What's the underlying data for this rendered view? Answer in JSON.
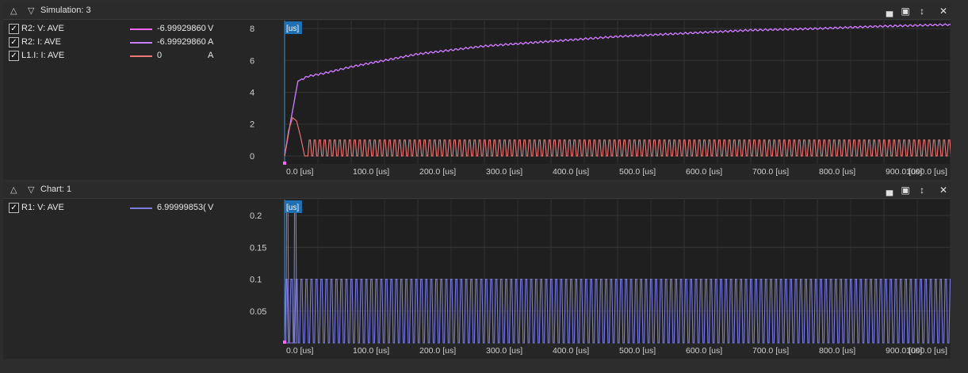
{
  "panes": [
    {
      "title": "Simulation: 3",
      "legend": [
        {
          "name": "R2: V: AVE",
          "value": "-6.99929860",
          "unit": "V",
          "color": "#ff66ff",
          "checked": true
        },
        {
          "name": "R2: I: AVE",
          "value": "-6.99929860",
          "unit": "A",
          "color": "#c77dff",
          "checked": true
        },
        {
          "name": "L1.I: I: AVE",
          "value": "0",
          "unit": "A",
          "color": "#f07878",
          "checked": true
        }
      ],
      "cursor_label": "[us]"
    },
    {
      "title": "Chart: 1",
      "legend": [
        {
          "name": "R1: V: AVE",
          "value": "6.99999853(",
          "unit": "V",
          "color": "#7b7be0",
          "checked": true
        }
      ],
      "cursor_label": "[us]"
    }
  ],
  "icons": [
    "collapse-up-icon",
    "expand-down-icon",
    "minimize-icon",
    "fit-icon",
    "autoscale-icon",
    "close-icon",
    "checkbox-icon"
  ],
  "chart_data": [
    {
      "type": "line",
      "xlim": [
        0,
        1000
      ],
      "ylim": [
        -0.5,
        8.5
      ],
      "x_ticks": [
        "0.0 [us]",
        "100.0 [us]",
        "200.0 [us]",
        "300.0 [us]",
        "400.0 [us]",
        "500.0 [us]",
        "600.0 [us]",
        "700.0 [us]",
        "800.0 [us]",
        "900.0 [us]",
        "1000.0 [us]"
      ],
      "y_ticks": [
        "0",
        "2",
        "4",
        "6",
        "8"
      ],
      "y_tick_values": [
        0,
        2,
        4,
        6,
        8
      ],
      "grid": true,
      "series": [
        {
          "name": "R2: V: AVE",
          "color": "#ff66ff",
          "x": [
            0,
            10,
            20,
            35,
            60,
            100,
            200,
            300,
            400,
            500,
            600,
            700,
            800,
            900,
            1000
          ],
          "y": [
            0,
            2.4,
            4.7,
            5.0,
            5.2,
            5.6,
            6.4,
            6.9,
            7.2,
            7.5,
            7.7,
            7.9,
            8.0,
            8.15,
            8.25
          ]
        },
        {
          "name": "R2: I: AVE",
          "color": "#c77dff",
          "x": [
            0,
            10,
            20,
            35,
            60,
            100,
            200,
            300,
            400,
            500,
            600,
            700,
            800,
            900,
            1000
          ],
          "y": [
            0,
            2.4,
            4.7,
            5.0,
            5.2,
            5.6,
            6.4,
            6.9,
            7.2,
            7.5,
            7.7,
            7.9,
            8.0,
            8.15,
            8.25
          ]
        },
        {
          "name": "L1.I: I: AVE",
          "color": "#f07878",
          "first_peak": {
            "x": [
              0,
              6,
              12,
              18,
              24,
              30
            ],
            "y": [
              0,
              1.6,
              2.4,
              2.2,
              1.2,
              0
            ]
          },
          "oscillation": {
            "start": 35,
            "period": 7.5,
            "min": 0,
            "max": 1.0
          }
        }
      ]
    },
    {
      "type": "line",
      "xlim": [
        0,
        1000
      ],
      "ylim": [
        0,
        0.225
      ],
      "x_ticks": [
        "0.0 [us]",
        "100.0 [us]",
        "200.0 [us]",
        "300.0 [us]",
        "400.0 [us]",
        "500.0 [us]",
        "600.0 [us]",
        "700.0 [us]",
        "800.0 [us]",
        "900.0 [us]",
        "1000.0 [us]"
      ],
      "y_ticks": [
        "0.05",
        "0.1",
        "0.15",
        "0.2"
      ],
      "y_tick_values": [
        0.05,
        0.1,
        0.15,
        0.2
      ],
      "grid": true,
      "series": [
        {
          "name": "R1: V: AVE",
          "color": "#7b7be0",
          "initial_peaks": [
            {
              "x": 4,
              "y": 0.22
            },
            {
              "x": 16,
              "y": 0.22
            }
          ],
          "oscillation": {
            "start": 0,
            "period": 7.5,
            "min": 0,
            "max": 0.1
          }
        }
      ]
    }
  ]
}
